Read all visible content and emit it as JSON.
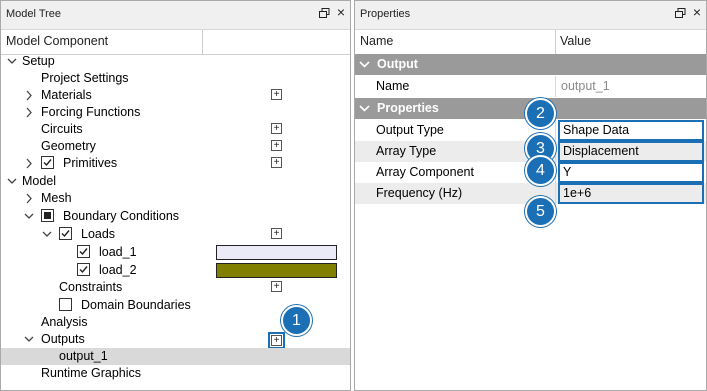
{
  "model_tree": {
    "title": "Model Tree",
    "column_header": "Model Component",
    "items": [
      {
        "label": "Setup"
      },
      {
        "label": "Project Settings"
      },
      {
        "label": "Materials"
      },
      {
        "label": "Forcing Functions"
      },
      {
        "label": "Circuits"
      },
      {
        "label": "Geometry"
      },
      {
        "label": "Primitives"
      },
      {
        "label": "Model"
      },
      {
        "label": "Mesh"
      },
      {
        "label": "Boundary Conditions"
      },
      {
        "label": "Loads"
      },
      {
        "label": "load_1",
        "color": "#ebebf7"
      },
      {
        "label": "load_2",
        "color": "#807f00"
      },
      {
        "label": "Constraints"
      },
      {
        "label": "Domain Boundaries"
      },
      {
        "label": "Analysis"
      },
      {
        "label": "Outputs"
      },
      {
        "label": "output_1"
      },
      {
        "label": "Runtime Graphics"
      }
    ]
  },
  "properties": {
    "title": "Properties",
    "col_name": "Name",
    "col_value": "Value",
    "sections": [
      {
        "label": "Output",
        "rows": [
          {
            "name": "Name",
            "value": "output_1"
          }
        ]
      },
      {
        "label": "Properties",
        "rows": [
          {
            "name": "Output Type",
            "value": "Shape Data"
          },
          {
            "name": "Array Type",
            "value": "Displacement"
          },
          {
            "name": "Array Component",
            "value": "Y"
          },
          {
            "name": "Frequency (Hz)",
            "value": "1e+6"
          }
        ]
      }
    ]
  },
  "callouts": [
    "1",
    "2",
    "3",
    "4",
    "5"
  ],
  "colors": {
    "accent": "#1b6fb5",
    "section_header": "#9a9a9a",
    "selection": "#d9d9d9"
  }
}
